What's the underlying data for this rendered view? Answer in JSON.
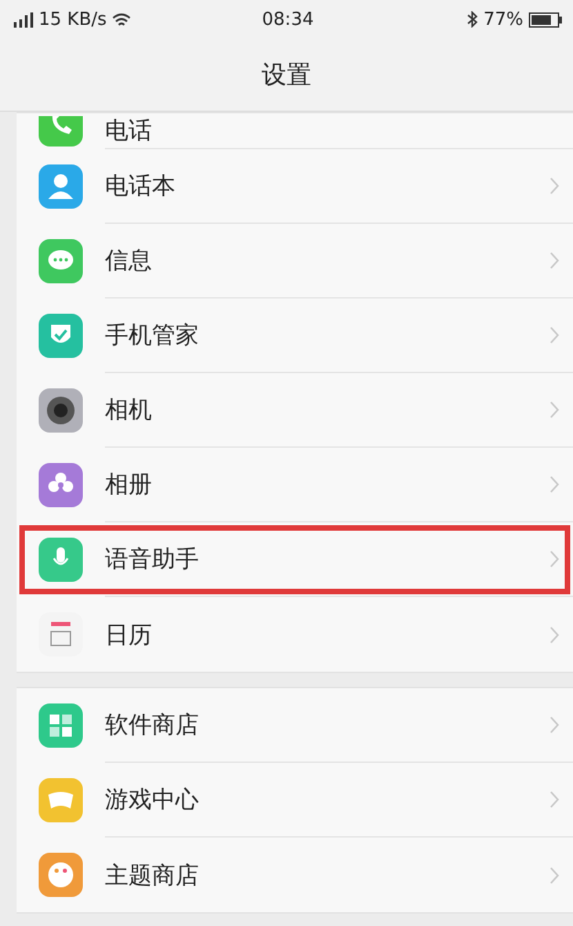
{
  "status_bar": {
    "speed": "15 KB/s",
    "time": "08:34",
    "battery": "77%"
  },
  "title": "设置",
  "groups": [
    {
      "items": [
        {
          "label": "电话",
          "highlighted": false
        },
        {
          "label": "电话本",
          "highlighted": false
        },
        {
          "label": "信息",
          "highlighted": false
        },
        {
          "label": "手机管家",
          "highlighted": false
        },
        {
          "label": "相机",
          "highlighted": false
        },
        {
          "label": "相册",
          "highlighted": false
        },
        {
          "label": "语音助手",
          "highlighted": true
        },
        {
          "label": "日历",
          "highlighted": false
        }
      ]
    },
    {
      "items": [
        {
          "label": "软件商店",
          "highlighted": false
        },
        {
          "label": "游戏中心",
          "highlighted": false
        },
        {
          "label": "主题商店",
          "highlighted": false
        }
      ]
    }
  ]
}
